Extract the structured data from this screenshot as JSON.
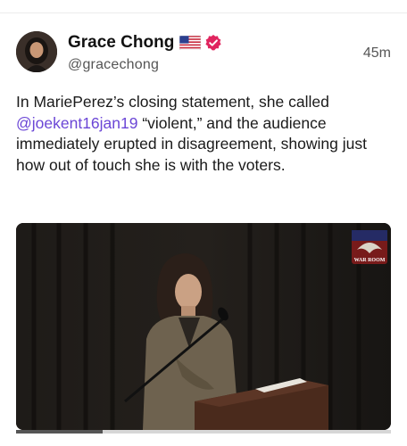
{
  "post": {
    "author": {
      "display_name": "Grace Chong",
      "handle": "@gracechong",
      "flag_icon": "us-flag-icon",
      "verified_icon": "verified-badge-icon",
      "verified_color": "#e0245e"
    },
    "time": "45m",
    "text_before": "In MariePerez’s closing statement, she called ",
    "mention": "@joekent16jan19",
    "text_after": " “violent,” and the audience immediately erupted in disagreement, showing just how out of touch she is with the voters.",
    "mention_color": "#6b46d6"
  },
  "media": {
    "type": "video",
    "watermark_icon": "war-room-logo",
    "watermark_text": "WAR ROOM",
    "progress": 0.23
  }
}
